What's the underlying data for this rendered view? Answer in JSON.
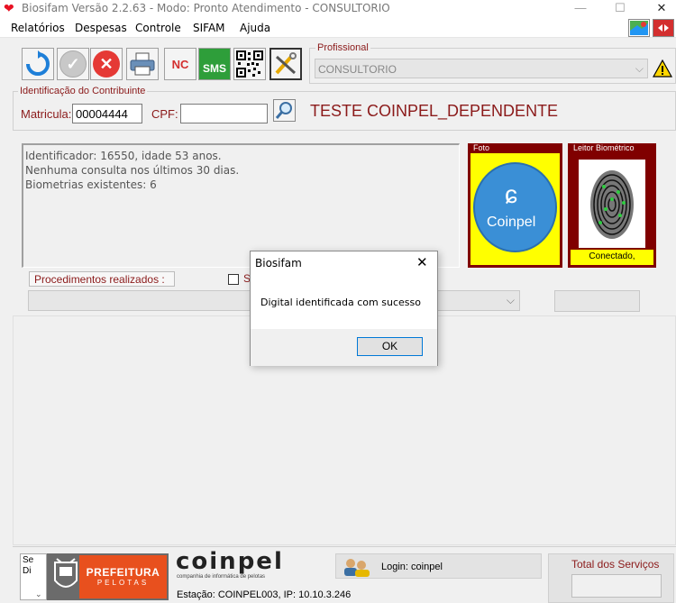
{
  "window": {
    "title": "Biosifam Versão 2.2.63 - Modo: Pronto Atendimento - CONSULTORIO",
    "minimize": "—",
    "maximize": "☐",
    "close": "✕"
  },
  "menu": [
    "Relatórios",
    "Despesas",
    "Controle",
    "SIFAM",
    "Ajuda"
  ],
  "toolbar": {
    "nc_label": "NC",
    "sms_label": "SMS"
  },
  "profissional": {
    "label": "Profissional",
    "value": "CONSULTORIO"
  },
  "contribuinte": {
    "label": "Identificação do Contribuinte",
    "matricula_label": "Matricula:",
    "matricula_value": "00004444",
    "cpf_label": "CPF:",
    "cpf_value": "",
    "name": "TESTE COINPEL_DEPENDENTE"
  },
  "info": {
    "line1": "Identificador: 16550, idade 53 anos.",
    "line2": "Nenhuma consulta nos últimos 30 dias.",
    "line3": "Biometrias existentes: 6"
  },
  "foto": {
    "label": "Foto",
    "logo_text": "Coinpel"
  },
  "leitor": {
    "label": "Leitor Biométrico",
    "status": "Conectado,"
  },
  "procedimentos": {
    "label": "Procedimentos realizados :",
    "checkbox_label": "S"
  },
  "dialog": {
    "title": "Biosifam",
    "message": "Digital identificada com sucesso",
    "ok": "OK"
  },
  "footer": {
    "side_text_1": "Se",
    "side_text_2": "Di",
    "prefeitura_line1": "PREFEITURA",
    "prefeitura_line2": "PELOTAS",
    "coinpel_brand": "coinpel",
    "coinpel_tagline": "companhia de informática de pelotas",
    "estacao": "Estação: COINPEL003, IP: 10.10.3.246",
    "login": "Login: coinpel",
    "total_label": "Total dos Serviços"
  },
  "colors": {
    "accent_red": "#8b1a1a",
    "maroon_frame": "#800000",
    "yellow": "#ffff00",
    "prefeitura_orange": "#e8501e",
    "coinpel_blue": "#3a8fd6"
  }
}
